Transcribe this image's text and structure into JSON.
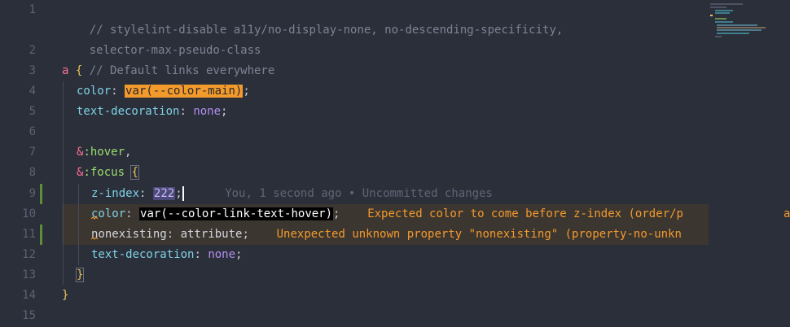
{
  "editor": {
    "line_numbers": [
      "1",
      "",
      "2",
      "3",
      "4",
      "5",
      "6",
      "7",
      "8",
      "9",
      "10",
      "11",
      "12",
      "13",
      "14",
      "15"
    ],
    "comment_1": "// stylelint-disable a11y/no-display-none, no-descending-specificity,",
    "comment_1_wrap": "selector-max-pseudo-class",
    "comment_2": "// Default links everywhere",
    "tag_a": "a",
    "brace_open": "{",
    "brace_close": "}",
    "prop_color": "color",
    "colon": ":",
    "semicolon": ";",
    "comma": ",",
    "var_main": "var(--color-main)",
    "prop_text_decoration": "text-decoration",
    "value_none": "none",
    "amp": "&",
    "sel_hover": ":hover",
    "sel_focus": ":focus",
    "prop_z_index": "z-index",
    "value_222": "222",
    "blame": "You, 1 second ago • Uncommitted changes",
    "var_link_hover": "var(--color-link-text-hover)",
    "error_order": "Expected color to come before z-index (order/p",
    "error_order_tail": "a",
    "prop_nonexisting": "nonexisting",
    "value_attribute": "attribute",
    "error_unknown": "Unexpected unknown property \"nonexisting\" (property-no-unkn"
  }
}
